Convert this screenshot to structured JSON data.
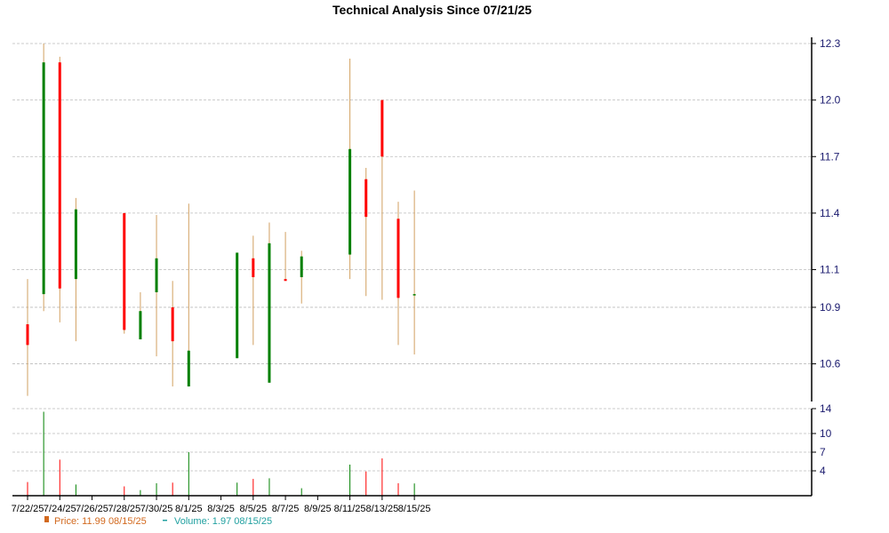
{
  "chart_data": {
    "type": "candlestick",
    "title": "Technical Analysis Since 07/21/25",
    "price_axis": {
      "ylim": [
        10.4,
        12.3
      ],
      "ticks": [
        10.6,
        10.9,
        11.1,
        11.4,
        11.7,
        12.0,
        12.3
      ]
    },
    "volume_axis": {
      "ylim": [
        0,
        14
      ],
      "ticks": [
        4,
        7,
        10,
        14
      ]
    },
    "x_tick_labels": [
      "7/22/25",
      "7/24/25",
      "7/26/25",
      "7/28/25",
      "7/30/25",
      "8/1/25",
      "8/3/25",
      "8/5/25",
      "8/7/25",
      "8/9/25",
      "8/11/25",
      "8/13/25",
      "8/15/25"
    ],
    "colors": {
      "up": "#008000",
      "down": "#ff0000",
      "wick": "#d2a060",
      "volume": "#20a0a0",
      "grid": "#bbbbbb"
    },
    "candles": [
      {
        "date": "7/22/25",
        "open": 10.81,
        "high": 11.05,
        "low": 10.43,
        "close": 10.7,
        "volume": 2.2
      },
      {
        "date": "7/23/25",
        "open": 10.97,
        "high": 12.3,
        "low": 10.88,
        "close": 12.2,
        "volume": 13.5
      },
      {
        "date": "7/24/25",
        "open": 12.2,
        "high": 12.23,
        "low": 10.82,
        "close": 11.0,
        "volume": 5.8
      },
      {
        "date": "7/25/25",
        "open": 11.05,
        "high": 11.48,
        "low": 10.72,
        "close": 11.42,
        "volume": 1.8
      },
      {
        "date": "7/28/25",
        "open": 11.4,
        "high": 11.4,
        "low": 10.76,
        "close": 10.78,
        "volume": 1.5
      },
      {
        "date": "7/29/25",
        "open": 10.73,
        "high": 10.98,
        "low": 10.73,
        "close": 10.88,
        "volume": 0.9
      },
      {
        "date": "7/30/25",
        "open": 10.98,
        "high": 11.39,
        "low": 10.64,
        "close": 11.16,
        "volume": 2.0
      },
      {
        "date": "7/31/25",
        "open": 10.9,
        "high": 11.04,
        "low": 10.48,
        "close": 10.72,
        "volume": 2.1
      },
      {
        "date": "8/1/25",
        "open": 10.48,
        "high": 11.45,
        "low": 10.48,
        "close": 10.67,
        "volume": 7.0
      },
      {
        "date": "8/4/25",
        "open": 10.63,
        "high": 11.19,
        "low": 10.63,
        "close": 11.19,
        "volume": 2.1
      },
      {
        "date": "8/5/25",
        "open": 11.16,
        "high": 11.28,
        "low": 10.7,
        "close": 11.06,
        "volume": 2.7
      },
      {
        "date": "8/6/25",
        "open": 10.5,
        "high": 11.35,
        "low": 10.5,
        "close": 11.24,
        "volume": 2.8
      },
      {
        "date": "8/7/25",
        "open": 11.05,
        "high": 11.3,
        "low": 11.05,
        "close": 11.04,
        "volume": 0.1
      },
      {
        "date": "8/8/25",
        "open": 11.06,
        "high": 11.2,
        "low": 10.92,
        "close": 11.17,
        "volume": 1.2
      },
      {
        "date": "8/11/25",
        "open": 11.18,
        "high": 12.22,
        "low": 11.05,
        "close": 11.74,
        "volume": 5.0
      },
      {
        "date": "8/12/25",
        "open": 11.58,
        "high": 11.64,
        "low": 10.96,
        "close": 11.38,
        "volume": 3.9
      },
      {
        "date": "8/13/25",
        "open": 12.0,
        "high": 12.0,
        "low": 10.94,
        "close": 11.7,
        "volume": 6.0
      },
      {
        "date": "8/14/25",
        "open": 11.37,
        "high": 11.46,
        "low": 10.7,
        "close": 10.95,
        "volume": 2.0
      },
      {
        "date": "8/15/25",
        "open": 10.97,
        "high": 11.52,
        "low": 10.65,
        "close": 10.97,
        "volume": 1.97
      }
    ],
    "legend": {
      "price_text": "Price: 11.99  08/15/25",
      "volume_text": "Volume: 1.97  08/15/25"
    }
  }
}
